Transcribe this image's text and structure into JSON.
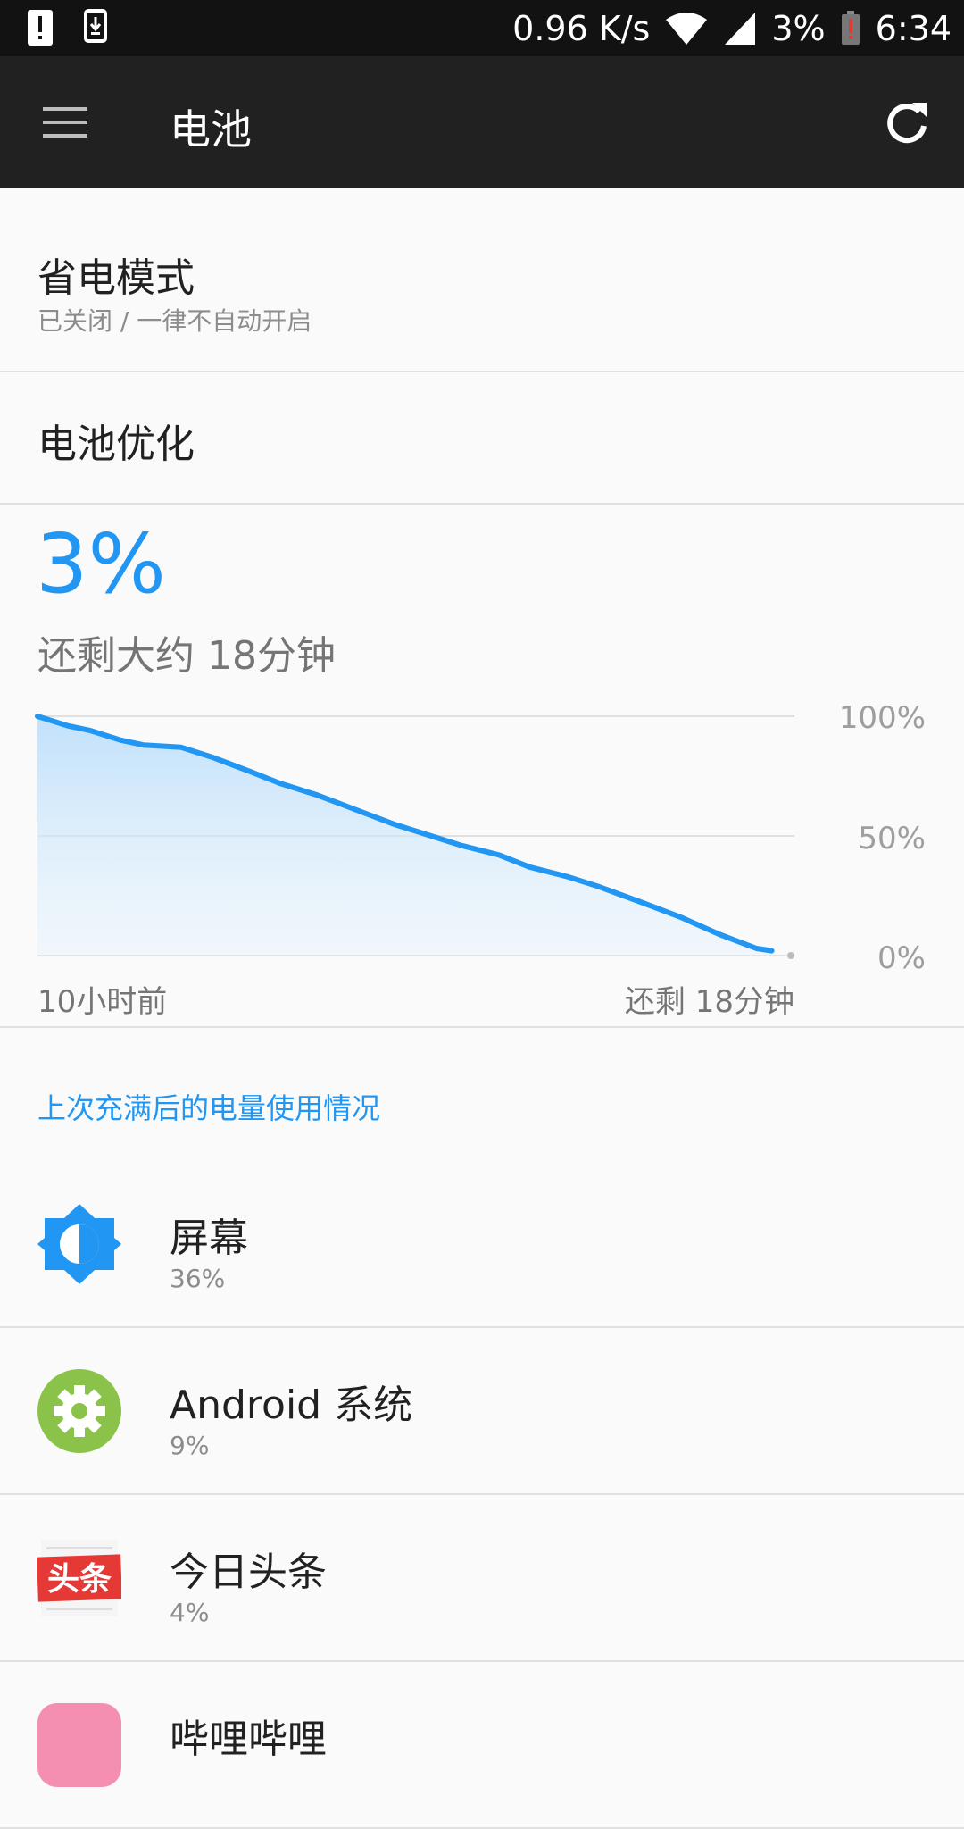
{
  "status_bar": {
    "net_speed": "0.96 K/s",
    "battery_text": "3%",
    "time": "6:34",
    "icons": [
      "alert-icon",
      "download-icon",
      "wifi-icon",
      "signal-icon",
      "battery-low-icon"
    ]
  },
  "toolbar": {
    "title": "电池",
    "menu_icon": "menu-icon",
    "refresh_icon": "refresh-icon"
  },
  "settings": {
    "power_saving": {
      "title": "省电模式",
      "subtitle": "已关闭 / 一律不自动开启"
    },
    "battery_optimization": {
      "title": "电池优化"
    }
  },
  "battery": {
    "percent_text": "3%",
    "remaining_text": "还剩大约 18分钟"
  },
  "chart_data": {
    "type": "area",
    "x_start_label": "10小时前",
    "x_end_label": "还剩 18分钟",
    "y_tick_labels": [
      "100%",
      "50%",
      "0%"
    ],
    "ylim": [
      0,
      100
    ],
    "x": [
      0,
      0.04,
      0.07,
      0.11,
      0.14,
      0.19,
      0.23,
      0.28,
      0.32,
      0.37,
      0.42,
      0.47,
      0.52,
      0.56,
      0.61,
      0.65,
      0.7,
      0.74,
      0.8,
      0.85,
      0.9,
      0.95,
      0.97
    ],
    "y": [
      100,
      96,
      94,
      90,
      88,
      87,
      83,
      77,
      72,
      67,
      61,
      55,
      50,
      46,
      42,
      37,
      33,
      29,
      22,
      16,
      9,
      3,
      2
    ],
    "color": "#2196f3",
    "grid": true
  },
  "usage": {
    "header": "上次充满后的电量使用情况",
    "items": [
      {
        "name": "屏幕",
        "percent": "36%",
        "icon": "brightness-icon",
        "color": "#2196f3"
      },
      {
        "name": "Android 系统",
        "percent": "9%",
        "icon": "settings-gear-icon",
        "color": "#8bc34a"
      },
      {
        "name": "今日头条",
        "percent": "4%",
        "icon": "toutiao-icon",
        "color": "#e53935",
        "icon_text": "头条"
      },
      {
        "name": "哔哩哔哩",
        "percent": "",
        "icon": "bilibili-icon",
        "color": "#f48fb1"
      }
    ]
  }
}
